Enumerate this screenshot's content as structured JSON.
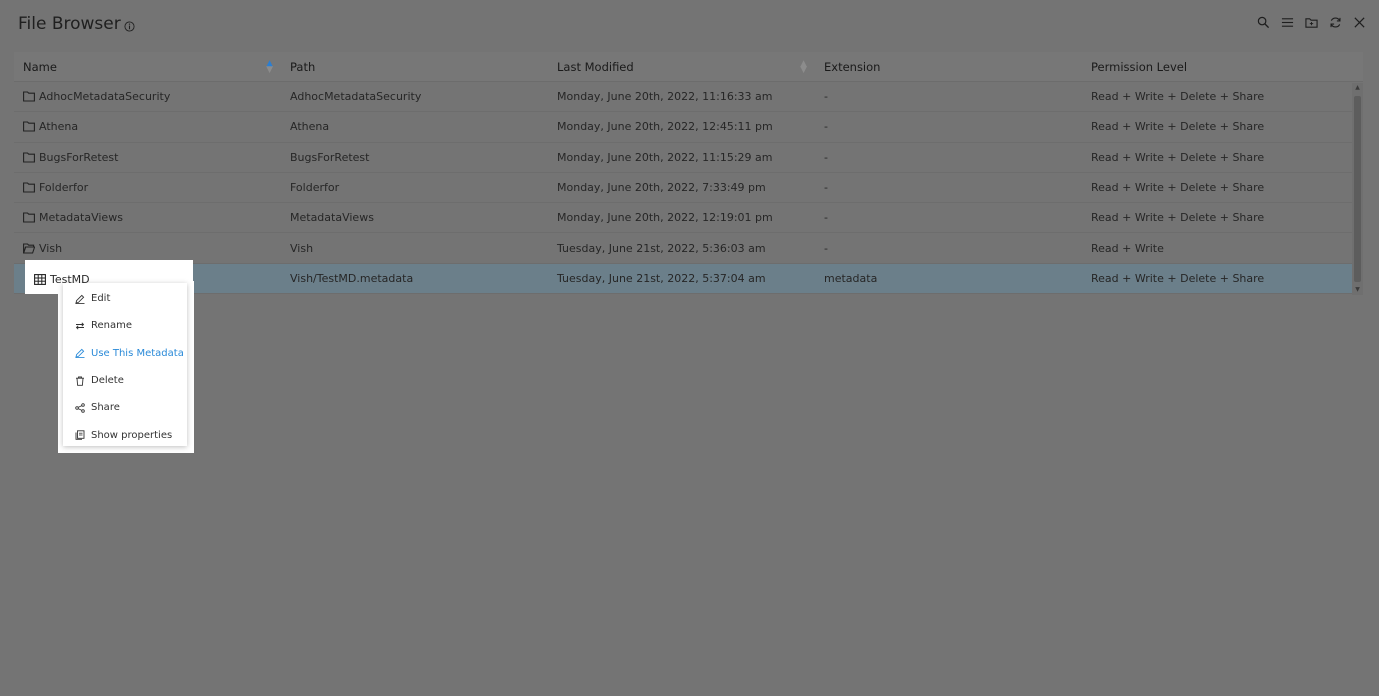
{
  "window": {
    "title": "File Browser",
    "info_icon": "info-icon"
  },
  "toolbar": {
    "icons": [
      "search-icon",
      "list-icon",
      "folder-icon",
      "refresh-icon",
      "close-icon"
    ]
  },
  "table": {
    "headers": [
      "Name",
      "Path",
      "Last Modified",
      "Extension",
      "Permission Level"
    ],
    "rows": [
      {
        "type": "folder",
        "name": "AdhocMetadataSecurity",
        "path": "AdhocMetadataSecurity",
        "modified": "Monday, June 20th, 2022, 11:16:33 am",
        "ext": "-",
        "perm": "Read + Write + Delete + Share"
      },
      {
        "type": "folder",
        "name": "Athena",
        "path": "Athena",
        "modified": "Monday, June 20th, 2022, 12:45:11 pm",
        "ext": "-",
        "perm": "Read + Write + Delete + Share"
      },
      {
        "type": "folder",
        "name": "BugsForRetest",
        "path": "BugsForRetest",
        "modified": "Monday, June 20th, 2022, 11:15:29 am",
        "ext": "-",
        "perm": "Read + Write + Delete + Share"
      },
      {
        "type": "folder",
        "name": "Folderfor",
        "path": "Folderfor",
        "modified": "Monday, June 20th, 2022, 7:33:49 pm",
        "ext": "-",
        "perm": "Read + Write + Delete + Share"
      },
      {
        "type": "folder",
        "name": "MetadataViews",
        "path": "MetadataViews",
        "modified": "Monday, June 20th, 2022, 12:19:01 pm",
        "ext": "-",
        "perm": "Read + Write + Delete + Share"
      },
      {
        "type": "folder-open",
        "name": "Vish",
        "path": "Vish",
        "modified": "Tuesday, June 21st, 2022, 5:36:03 am",
        "ext": "-",
        "perm": "Read + Write"
      },
      {
        "type": "table",
        "name": "TestMD",
        "path": "Vish/TestMD.metadata",
        "modified": "Tuesday, June 21st, 2022, 5:37:04 am",
        "ext": "metadata",
        "perm": "Read + Write + Delete + Share"
      }
    ]
  },
  "context_menu": {
    "items": [
      {
        "label": "Edit",
        "icon": "pencil-icon"
      },
      {
        "label": "Rename",
        "icon": "rename-icon"
      },
      {
        "label": "Use This Metadata",
        "icon": "pencil-icon"
      },
      {
        "label": "Delete",
        "icon": "trash-icon"
      },
      {
        "label": "Share",
        "icon": "share-icon"
      },
      {
        "label": "Show properties",
        "icon": "properties-icon"
      }
    ]
  },
  "colors": {
    "accent": "#2a8ad8",
    "sort_active": "#2a7fd4",
    "selected_row": "#6b7f8a",
    "background": "#747474"
  }
}
